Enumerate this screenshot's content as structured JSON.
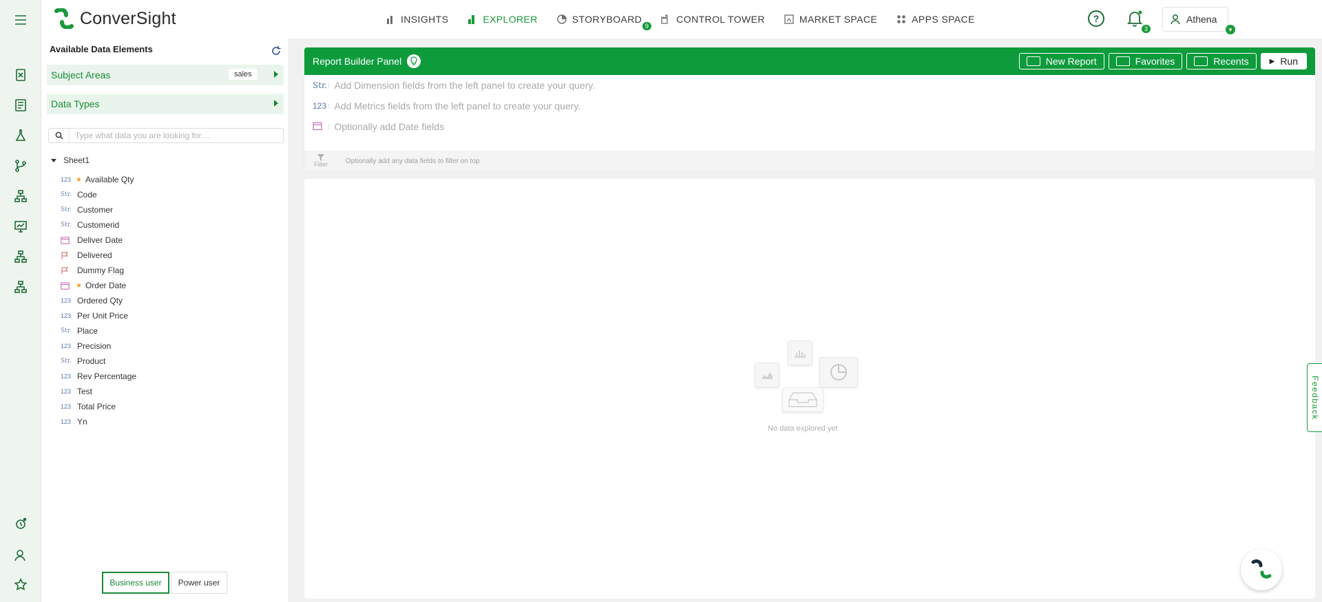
{
  "app": {
    "brand": "ConverSight"
  },
  "nav": {
    "items": [
      {
        "label": "INSIGHTS",
        "icon": "bar-chart-icon",
        "active": false
      },
      {
        "label": "EXPLORER",
        "icon": "explorer-chart-icon",
        "active": true
      },
      {
        "label": "STORYBOARD",
        "icon": "storyboard-icon",
        "active": false,
        "badge": "9"
      },
      {
        "label": "CONTROL TOWER",
        "icon": "factory-icon",
        "active": false
      },
      {
        "label": "MARKET SPACE",
        "icon": "market-icon",
        "active": false
      },
      {
        "label": "APPS SPACE",
        "icon": "apps-grid-icon",
        "active": false
      }
    ],
    "notification_count": "3",
    "user_name": "Athena"
  },
  "sidebar": {
    "title": "Available Data Elements",
    "subject_areas_label": "Subject Areas",
    "subject_area_value": "sales",
    "data_types_label": "Data Types",
    "search_placeholder": "Type what data you are looking for....",
    "tree_root": "Sheet1",
    "fields": [
      {
        "type": "123",
        "kind": "metric",
        "starred": true,
        "label": "Available Qty"
      },
      {
        "type": "Str.",
        "kind": "str",
        "starred": false,
        "label": "Code"
      },
      {
        "type": "Str.",
        "kind": "str",
        "starred": false,
        "label": "Customer"
      },
      {
        "type": "Str.",
        "kind": "str",
        "starred": false,
        "label": "Customerid"
      },
      {
        "type": "",
        "kind": "date",
        "starred": false,
        "label": "Deliver Date"
      },
      {
        "type": "",
        "kind": "flag",
        "starred": false,
        "label": "Delivered"
      },
      {
        "type": "",
        "kind": "flag",
        "starred": false,
        "label": "Dummy Flag"
      },
      {
        "type": "",
        "kind": "date",
        "starred": true,
        "label": "Order Date"
      },
      {
        "type": "123",
        "kind": "metric",
        "starred": false,
        "label": "Ordered Qty"
      },
      {
        "type": "123",
        "kind": "metric",
        "starred": false,
        "label": "Per Unit Price"
      },
      {
        "type": "Str.",
        "kind": "str",
        "starred": false,
        "label": "Place"
      },
      {
        "type": "123",
        "kind": "metric",
        "starred": false,
        "label": "Precision"
      },
      {
        "type": "Str.",
        "kind": "str",
        "starred": false,
        "label": "Product"
      },
      {
        "type": "123",
        "kind": "metric",
        "starred": false,
        "label": "Rev Percentage"
      },
      {
        "type": "123",
        "kind": "metric",
        "starred": false,
        "label": "Test"
      },
      {
        "type": "123",
        "kind": "metric",
        "starred": false,
        "label": "Total Price"
      },
      {
        "type": "123",
        "kind": "metric",
        "starred": false,
        "label": "Yn"
      }
    ],
    "mode_business": "Business user",
    "mode_power": "Power user"
  },
  "report_builder": {
    "title": "Report Builder Panel",
    "new_report": "New Report",
    "favorites": "Favorites",
    "recents": "Recents",
    "run": "Run",
    "dimension_tag": "Str.",
    "dimension_hint": "Add Dimension fields from the left panel to create your query.",
    "metric_tag": "123",
    "metric_hint": "Add Metrics fields from the left panel to create your query.",
    "date_hint": "Optionally add Date fields",
    "filter_label": "Filter",
    "filter_hint": "Optionally add any data fields to filter on top"
  },
  "canvas": {
    "empty_text": "No data explored yet"
  },
  "feedback_label": "Feedback",
  "colors": {
    "brand_green": "#0e9b3c",
    "accent_green": "#1a8a36",
    "rail_bg": "#eef5ef"
  }
}
